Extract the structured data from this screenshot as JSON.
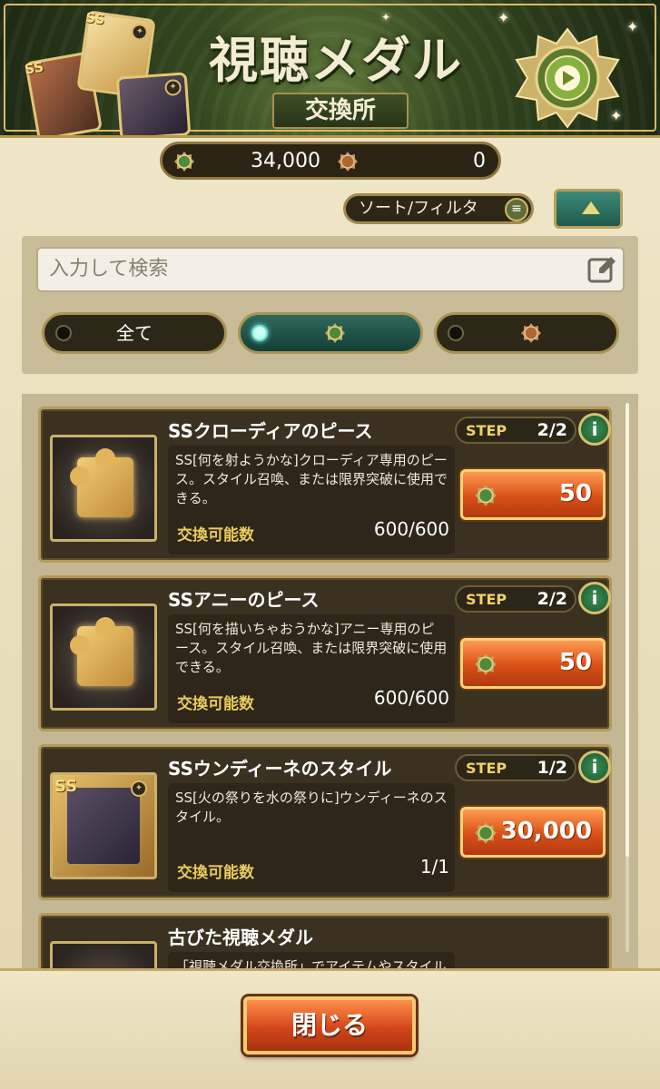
{
  "banner": {
    "title": "視聴メダル",
    "subtitle": "交換所",
    "icon": "medal-emblem-icon"
  },
  "currency": {
    "green_medal_icon": "green-medal-icon",
    "green_medal_value": "34,000",
    "bronze_medal_icon": "bronze-medal-icon",
    "bronze_medal_value": "0"
  },
  "controls": {
    "sort_filter_label": "ソート/フィルタ",
    "sort_icon": "list-icon",
    "scroll_top_icon": "triangle-up-icon"
  },
  "search": {
    "placeholder": "入力して検索",
    "icon": "edit-icon"
  },
  "filter_tabs": [
    {
      "label": "全て",
      "active": false
    },
    {
      "label": "",
      "icon": "green-medal-icon",
      "active": true
    },
    {
      "label": "",
      "icon": "bronze-medal-icon",
      "active": false
    }
  ],
  "items": [
    {
      "name": "SSクローディアのピース",
      "description": "SS[何を射ようかな]クローディア専用のピース。スタイル召喚、または限界突破に使用できる。",
      "step_label": "STEP",
      "step": "2/2",
      "price": "50",
      "exchange_label": "交換可能数",
      "exchange_count": "600/600"
    },
    {
      "name": "SSアニーのピース",
      "description": "SS[何を描いちゃおうかな]アニー専用のピース。スタイル召喚、または限界突破に使用できる。",
      "step_label": "STEP",
      "step": "2/2",
      "price": "50",
      "exchange_label": "交換可能数",
      "exchange_count": "600/600"
    },
    {
      "name": "SSウンディーネのスタイル",
      "description": "SS[火の祭りを水の祭りに]ウンディーネのスタイル。",
      "step_label": "STEP",
      "step": "1/2",
      "price": "30,000",
      "exchange_label": "交換可能数",
      "exchange_count": "1/1"
    },
    {
      "name": "古びた視聴メダル",
      "description": "「視聴メダル交換所」でアイテムやスタイル"
    }
  ],
  "footer": {
    "close_label": "閉じる"
  },
  "colors": {
    "accent_green": "#1f5a4c",
    "price_orange": "#d94f16",
    "gold_border": "#b39a58",
    "label_yellow": "#e8cc5e"
  }
}
